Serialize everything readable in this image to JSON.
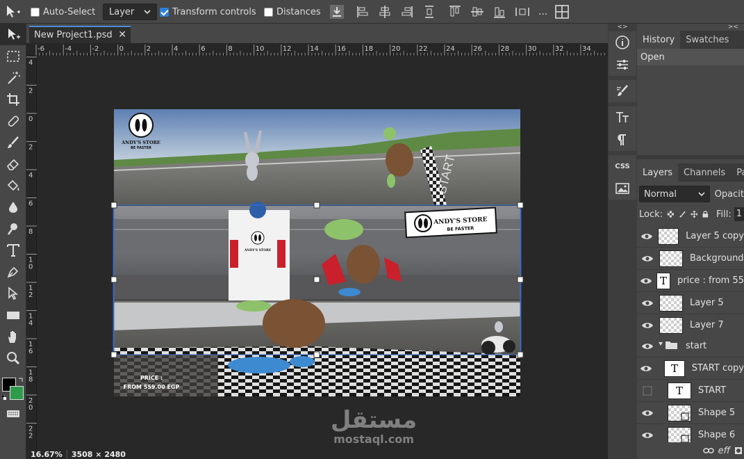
{
  "toolbar": {
    "auto_select_label": "Auto-Select",
    "auto_select_checked": false,
    "layer_select_value": "Layer",
    "transform_controls_label": "Transform controls",
    "transform_controls_checked": true,
    "distances_label": "Distances",
    "distances_checked": false,
    "more_label": "..."
  },
  "document": {
    "tab_title": "New Project1.psd",
    "zoom": "16.67%",
    "dimensions": "3508 × 2480"
  },
  "ruler_top": [
    "-6",
    "-4",
    "-2",
    "0",
    "2",
    "4",
    "6",
    "8",
    "10",
    "12",
    "14",
    "16",
    "18",
    "20",
    "22",
    "24",
    "26",
    "28",
    "30",
    "32",
    "34"
  ],
  "ruler_left": [
    "4",
    "2",
    "0",
    "2",
    "4",
    "6",
    "8",
    "1\n0",
    "1\n2",
    "1\n4",
    "1\n6",
    "1\n8",
    "2\n0",
    "2\n2"
  ],
  "artwork": {
    "brand_name": "ANDY'S STORE",
    "brand_tagline": "BE FASTER",
    "start_text": "START",
    "price_label": "PRICE :",
    "price_value": "FROM 559.00 EGP"
  },
  "history_panel": {
    "tabs": [
      "History",
      "Swatches"
    ],
    "items": [
      "Open"
    ]
  },
  "layers_panel": {
    "tabs": [
      "Layers",
      "Channels",
      "Pa"
    ],
    "blend_mode": "Normal",
    "opacity_label": "Opacit",
    "lock_label": "Lock:",
    "fill_label": "Fill:",
    "fill_value": "1",
    "layers": [
      {
        "name": "Layer 5 copy",
        "kind": "raster",
        "visible": true,
        "indent": 0
      },
      {
        "name": "Background",
        "kind": "raster",
        "visible": true,
        "indent": 0
      },
      {
        "name": "price : from 55",
        "kind": "text",
        "visible": true,
        "indent": 0
      },
      {
        "name": "Layer 5",
        "kind": "raster",
        "visible": true,
        "indent": 0
      },
      {
        "name": "Layer 7",
        "kind": "raster",
        "visible": true,
        "indent": 0
      },
      {
        "name": "start",
        "kind": "folder",
        "visible": true,
        "indent": 0
      },
      {
        "name": "START copy",
        "kind": "text",
        "visible": true,
        "indent": 1
      },
      {
        "name": "START",
        "kind": "text",
        "visible": false,
        "indent": 1
      },
      {
        "name": "Shape 5",
        "kind": "shape",
        "visible": true,
        "indent": 1
      },
      {
        "name": "Shape 6",
        "kind": "shape",
        "visible": true,
        "indent": 1
      }
    ],
    "footer_label": "eff"
  },
  "watermark": {
    "arabic": "مستقل",
    "latin": "mostaql.com"
  },
  "colors": {
    "accent": "#2f7fd8",
    "foreground_swatch": "#000000",
    "background_swatch": "#2e9b4a"
  }
}
